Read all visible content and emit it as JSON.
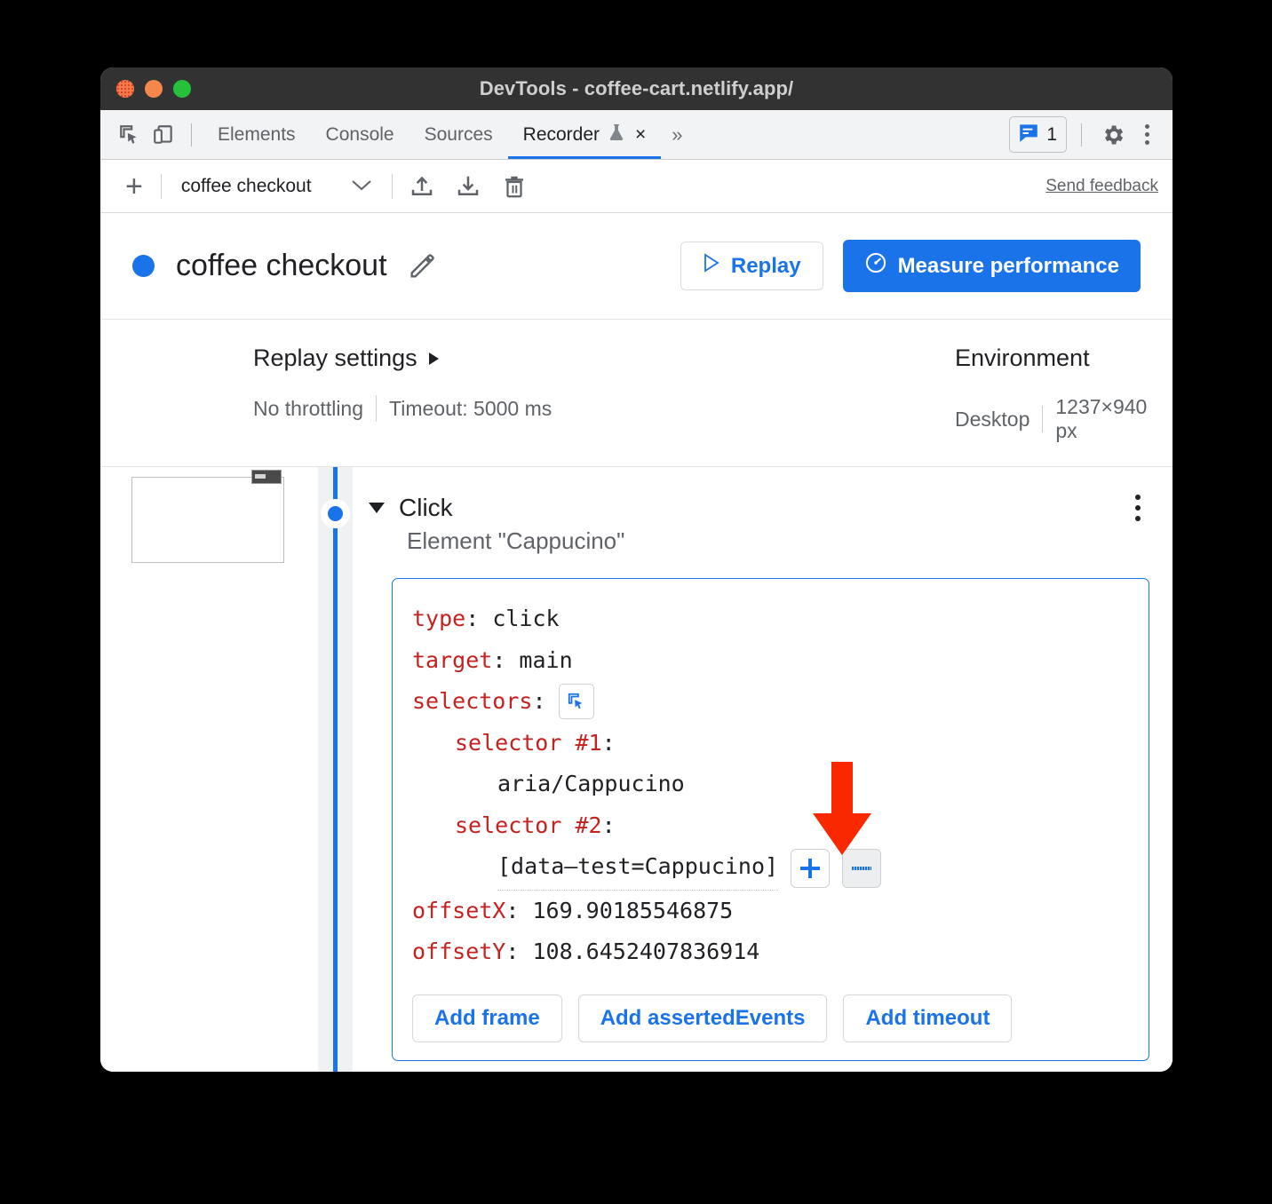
{
  "window": {
    "title": "DevTools - coffee-cart.netlify.app/",
    "traffic_lights": [
      "close",
      "minimize",
      "maximize"
    ]
  },
  "devtools_tabs": {
    "left_icons": [
      "inspect-element-icon",
      "device-toolbar-icon"
    ],
    "tabs": [
      {
        "label": "Elements",
        "active": false
      },
      {
        "label": "Console",
        "active": false
      },
      {
        "label": "Sources",
        "active": false
      },
      {
        "label": "Recorder",
        "active": true,
        "experimental": true,
        "closable": true,
        "close_label": "×"
      }
    ],
    "more_tabs_label": "»",
    "issues_count": "1",
    "right_icons": [
      "issues-icon",
      "settings-gear-icon",
      "more-options-icon"
    ]
  },
  "recorder_toolbar": {
    "add_label": "+",
    "recording_name": "coffee checkout",
    "dropdown_caret": "∨",
    "icons": [
      "export-icon",
      "import-icon",
      "delete-icon"
    ],
    "send_feedback": "Send feedback"
  },
  "recording_header": {
    "status_dot_color": "#1a73e8",
    "title": "coffee checkout",
    "edit_icon": "pencil-icon",
    "replay_label": "Replay",
    "replay_icon": "play-icon",
    "measure_label": "Measure performance",
    "measure_icon": "performance-icon"
  },
  "settings": {
    "replay": {
      "title": "Replay settings",
      "throttling": "No throttling",
      "timeout": "Timeout: 5000 ms"
    },
    "environment": {
      "title": "Environment",
      "device": "Desktop",
      "viewport": "1237×940 px"
    }
  },
  "step": {
    "type": "Click",
    "description": "Element \"Cappucino\"",
    "menu_icon": "step-more-icon",
    "fields": {
      "type_key": "type",
      "type_value": "click",
      "target_key": "target",
      "target_value": "main",
      "selectors_key": "selectors",
      "selectors_inspect_icon": "select-element-icon",
      "selector1_key": "selector #1",
      "selector1_value": "aria/Cappucino",
      "selector2_key": "selector #2",
      "selector2_value": "[data–test=Cappucino]",
      "selector_add_label": "+",
      "selector_remove_label": "–",
      "offsetx_key": "offsetX",
      "offsetx_value": "169.90185546875",
      "offsety_key": "offsetY",
      "offsety_value": "108.6452407836914"
    },
    "add_buttons": [
      "Add frame",
      "Add assertedEvents",
      "Add timeout"
    ]
  },
  "annotation": {
    "arrow": "red-down-arrow",
    "arrow_color": "#fa2800",
    "points_at": "selector-remove-button"
  }
}
